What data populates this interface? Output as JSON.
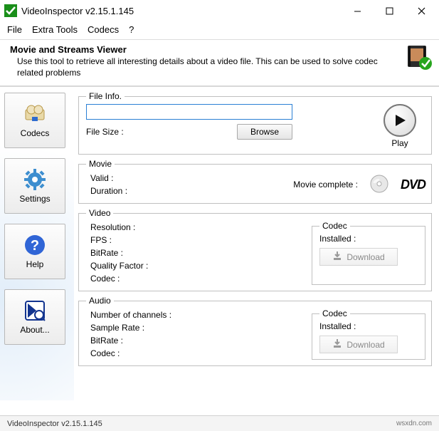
{
  "window": {
    "title": "VideoInspector v2.15.1.145",
    "minimize": "–",
    "maximize": "▢",
    "close": "✕"
  },
  "menu": {
    "file": "File",
    "extra": "Extra Tools",
    "codecs": "Codecs",
    "help": "?"
  },
  "banner": {
    "title": "Movie and Streams Viewer",
    "desc": "Use this tool to retrieve all interesting details about a video file. This can be used to solve codec related problems"
  },
  "sidebar": {
    "codecs": "Codecs",
    "settings": "Settings",
    "help": "Help",
    "about": "About..."
  },
  "file": {
    "legend": "File Info.",
    "value": "",
    "sizeLabel": "File Size :",
    "browse": "Browse",
    "play": "Play"
  },
  "movie": {
    "legend": "Movie",
    "valid": "Valid :",
    "complete": "Movie complete :",
    "duration": "Duration :",
    "dvd": "DVD"
  },
  "video": {
    "legend": "Video",
    "resolution": "Resolution :",
    "fps": "FPS :",
    "bitrate": "BitRate :",
    "quality": "Quality Factor :",
    "codec": "Codec :"
  },
  "audio": {
    "legend": "Audio",
    "channels": "Number of channels :",
    "sample": "Sample Rate :",
    "bitrate": "BitRate :",
    "codec": "Codec :"
  },
  "codecbox": {
    "legend": "Codec",
    "installed": "Installed :",
    "download": "Download"
  },
  "status": {
    "text": "VideoInspector v2.15.1.145",
    "watermark": "wsxdn.com"
  }
}
